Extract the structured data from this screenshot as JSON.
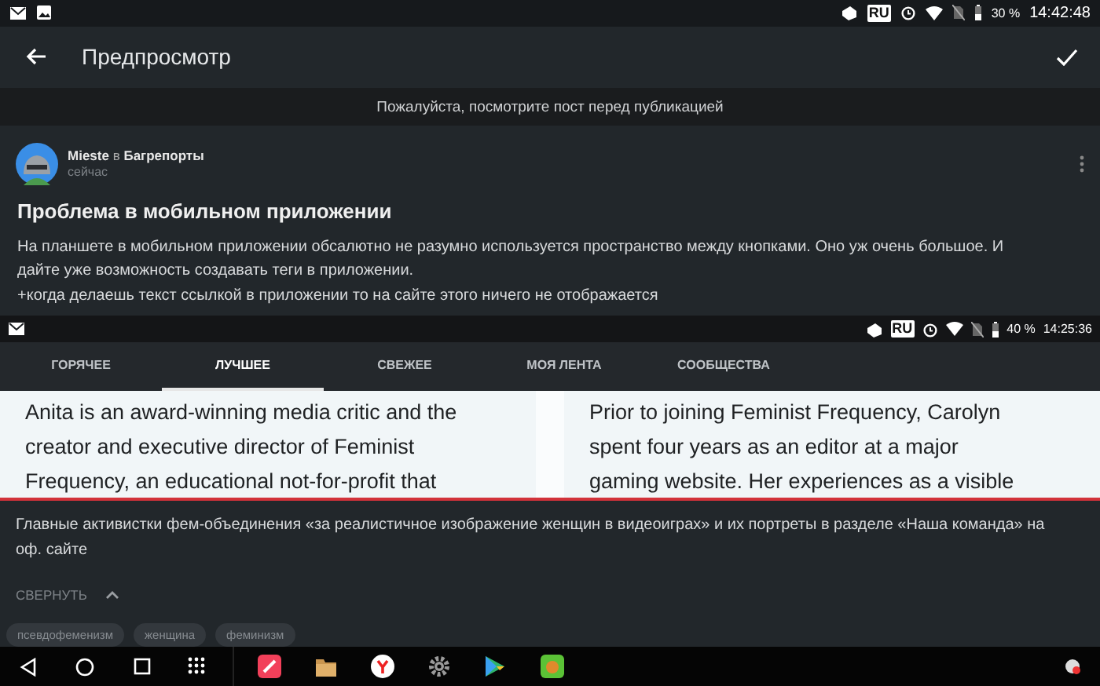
{
  "status_bar": {
    "language": "RU",
    "battery": "30 %",
    "time": "14:42:48"
  },
  "toolbar": {
    "title": "Предпросмотр"
  },
  "notice": "Пожалуйста, посмотрите пост перед публикацией",
  "post": {
    "author": "Mieste",
    "preposition": "в",
    "community": "Багрепорты",
    "time": "сейчас",
    "title": "Проблема в мобильном приложении",
    "paragraphs": [
      "На планшете в мобильном приложении обсалютно не разумно используется пространство между кнопками. Оно уж очень большое. И дайте уже возможность создавать теги в приложении.",
      "+когда делаешь текст ссылкой в приложении то на сайте этого ничего не отображается"
    ],
    "screenshot": {
      "status_bar": {
        "language": "RU",
        "battery": "40 %",
        "time": "14:25:36"
      },
      "tabs": [
        {
          "label": "ГОРЯЧЕЕ",
          "selected": false
        },
        {
          "label": "ЛУЧШЕЕ",
          "selected": true
        },
        {
          "label": "СВЕЖЕЕ",
          "selected": false
        },
        {
          "label": "МОЯ ЛЕНТА",
          "selected": false
        },
        {
          "label": "СООБЩЕСТВА",
          "selected": false
        }
      ],
      "columns": [
        [
          "Anita is an award-winning media critic and the",
          "creator and executive director of Feminist",
          "Frequency, an educational not-for-profit that"
        ],
        [
          "Prior to joining Feminist Frequency, Carolyn",
          "spent four years as an editor at a major",
          "gaming website. Her experiences as a visible"
        ]
      ]
    },
    "caption": "Главные активистки фем-объединения «за реалистичное изображение женщин в видеоиграх» и их портреты в разделе «Наша команда» на оф. сайте",
    "collapse": "СВЕРНУТЬ",
    "tags": [
      "псевдофеменизм",
      "женщина",
      "феминизм"
    ]
  }
}
